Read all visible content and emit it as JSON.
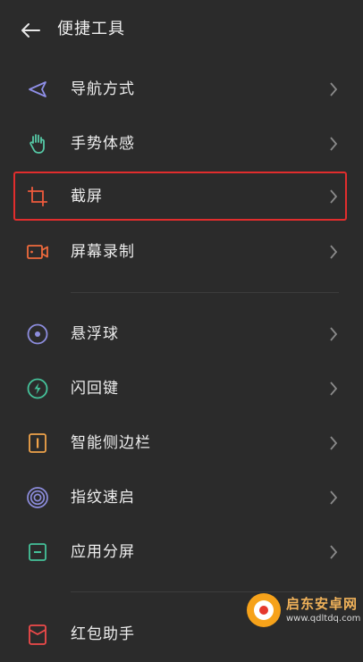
{
  "header": {
    "back_icon": "arrow-left-icon",
    "title": "便捷工具"
  },
  "group1": [
    {
      "label": "导航方式",
      "icon": "navigation-arrow-icon",
      "color": "#8f8fe8"
    },
    {
      "label": "手势体感",
      "icon": "hand-gesture-icon",
      "color": "#56c9a6"
    },
    {
      "label": "截屏",
      "icon": "crop-icon",
      "color": "#ef5a3c",
      "highlighted": true
    },
    {
      "label": "屏幕录制",
      "icon": "video-record-icon",
      "color": "#ef6a3c"
    }
  ],
  "group2": [
    {
      "label": "悬浮球",
      "icon": "floating-ball-icon",
      "color": "#8d8dde"
    },
    {
      "label": "闪回键",
      "icon": "flash-back-icon",
      "color": "#45c29a"
    },
    {
      "label": "智能侧边栏",
      "icon": "smart-sidebar-icon",
      "color": "#f0a34a"
    },
    {
      "label": "指纹速启",
      "icon": "fingerprint-icon",
      "color": "#8d8dde"
    },
    {
      "label": "应用分屏",
      "icon": "split-screen-icon",
      "color": "#45c29a"
    }
  ],
  "group3": [
    {
      "label": "红包助手",
      "icon": "red-envelope-icon",
      "color": "#ef4a4a"
    }
  ],
  "colors": {
    "background": "#2b2b2b",
    "highlight_border": "#e12d2d",
    "chevron": "#8a8a8a"
  },
  "watermark": {
    "line1": "启东安卓网",
    "line2": "www.qdltdq.com"
  }
}
